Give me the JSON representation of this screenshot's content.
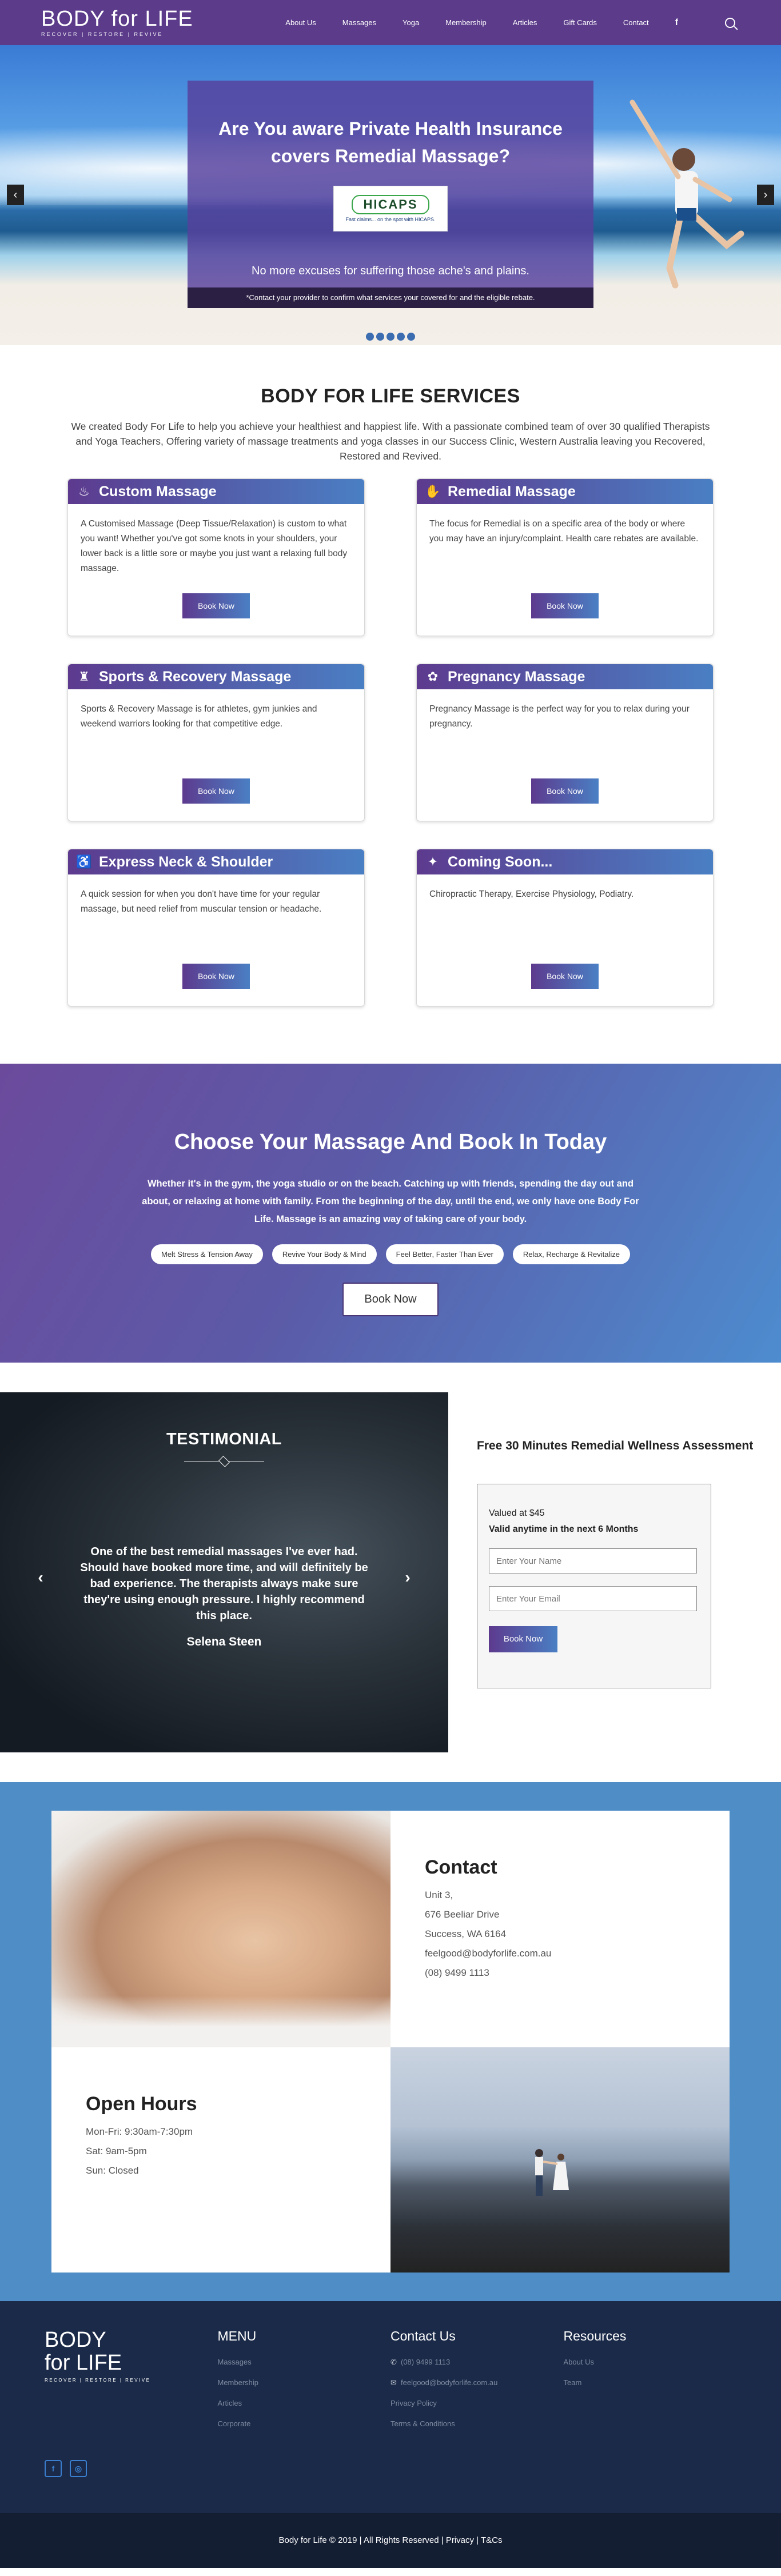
{
  "header": {
    "logo_title": "BODY for LIFE",
    "logo_tagline": "RECOVER | RESTORE | REVIVE",
    "nav": [
      "About Us",
      "Massages",
      "Yoga",
      "Membership",
      "Articles",
      "Gift Cards",
      "Contact"
    ],
    "facebook": "f",
    "search_icon": "search-icon"
  },
  "hero": {
    "title": "Are You aware Private Health Insurance covers Remedial Massage?",
    "hicaps_logo": "HICAPS",
    "hicaps_tagline": "Fast claims... on the spot with HICAPS.",
    "subtitle": "No more excuses for suffering those ache's and plains.",
    "note": "*Contact your provider to confirm what services your covered for and the eligible rebate.",
    "prev": "‹",
    "next": "›",
    "slides": 5
  },
  "services": {
    "heading": "BODY FOR LIFE SERVICES",
    "intro": "We created Body For Life to help you achieve your healthiest and happiest life. With a passionate combined team of over 30 qualified Therapists and Yoga Teachers, Offering variety of massage treatments and yoga classes in our Success Clinic, Western Australia leaving you Recovered, Restored and Revived.",
    "cards": [
      {
        "title": "Custom Massage",
        "icon": "massage-icon",
        "glyph": "♨",
        "body": "A Customised Massage (Deep Tissue/Relaxation) is custom to what you want! Whether you've got some knots in your shoulders, your lower back is a little sore or maybe you just want a relaxing full body massage.",
        "button": "Book Now"
      },
      {
        "title": "Remedial Massage",
        "icon": "remedial-icon",
        "glyph": "✋",
        "body": "The focus for Remedial is on a specific area of the body or where you may have an injury/complaint. Health care rebates are available.",
        "button": "Book Now"
      },
      {
        "title": "Sports & Recovery Massage",
        "icon": "sports-icon",
        "glyph": "♜",
        "body": "Sports & Recovery Massage is for athletes, gym junkies and weekend warriors looking for that competitive edge.",
        "button": "Book Now"
      },
      {
        "title": "Pregnancy Massage",
        "icon": "pregnancy-icon",
        "glyph": "✿",
        "body": "Pregnancy Massage is the perfect way for you to relax during your pregnancy.",
        "button": "Book Now"
      },
      {
        "title": "Express Neck & Shoulder",
        "icon": "neck-icon",
        "glyph": "♿",
        "body": "A quick session for when you don't have time for your regular massage, but need relief from muscular tension or headache.",
        "button": "Book Now"
      },
      {
        "title": "Coming Soon...",
        "icon": "coming-soon-icon",
        "glyph": "✦",
        "body": "Chiropractic Therapy, Exercise Physiology, Podiatry.",
        "button": "Book Now"
      }
    ]
  },
  "choose": {
    "heading": "Choose Your Massage And Book In Today",
    "text": "Whether it's in the gym, the yoga studio or on the beach. Catching up with friends, spending the day out and about, or relaxing at home with family. From the beginning of the day, until the end, we only have one Body For Life. Massage is an amazing way of taking care of your body.",
    "pills": [
      "Melt Stress & Tension Away",
      "Revive Your Body & Mind",
      "Feel Better, Faster Than Ever",
      "Relax, Recharge & Revitalize"
    ],
    "button": "Book Now"
  },
  "testimonial": {
    "heading": "TESTIMONIAL",
    "quote": "One of the best remedial massages I've ever had. Should have booked more time, and will definitely be bad experience. The therapists always make sure they're using enough pressure. I highly recommend this place.",
    "author": "Selena Steen",
    "prev": "‹",
    "next": "›"
  },
  "offer": {
    "heading": "Free 30 Minutes Remedial Wellness Assessment",
    "value": "Valued at $45",
    "valid": "Valid anytime in the next 6 Months",
    "name_placeholder": "Enter Your Name",
    "email_placeholder": "Enter Your Email",
    "button": "Book Now"
  },
  "contact": {
    "heading": "Contact",
    "lines": [
      "Unit 3,",
      "676 Beeliar Drive",
      "Success, WA 6164",
      "feelgood@bodyforlife.com.au",
      "(08) 9499 1113"
    ]
  },
  "hours": {
    "heading": "Open Hours",
    "lines": [
      "Mon-Fri: 9:30am-7:30pm",
      "Sat: 9am-5pm",
      "Sun: Closed"
    ]
  },
  "footer": {
    "logo_a": "BODY",
    "logo_b": "for LIFE",
    "logo_tagline": "RECOVER | RESTORE | REVIVE",
    "menu_heading": "MENU",
    "menu": [
      "Massages",
      "Membership",
      "Articles",
      "Corporate"
    ],
    "contact_heading": "Contact Us",
    "contact": [
      "(08) 9499 1113",
      "feelgood@bodyforlife.com.au",
      "Privacy Policy",
      "Terms & Conditions"
    ],
    "resources_heading": "Resources",
    "resources": [
      "About Us",
      "Team"
    ],
    "social": [
      "f",
      "◎"
    ],
    "copyright": "Body for Life © 2019 | All Rights Reserved | Privacy | T&Cs"
  }
}
